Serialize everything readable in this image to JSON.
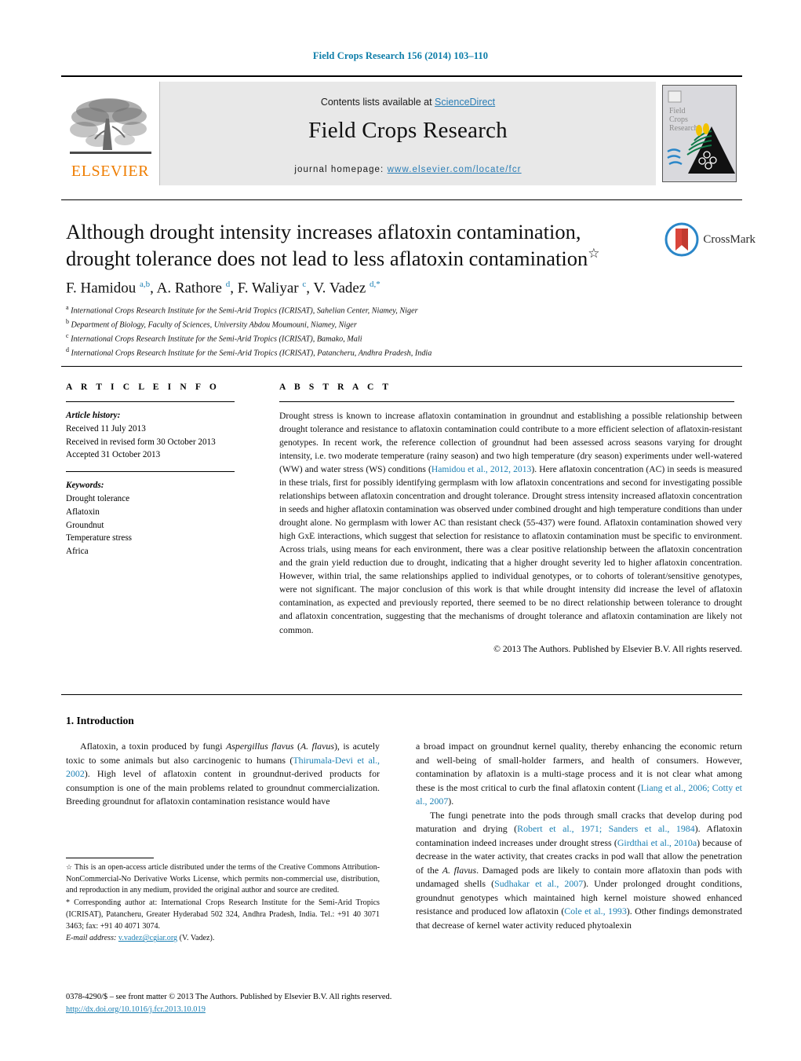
{
  "running_head": "Field Crops Research 156 (2014) 103–110",
  "masthead": {
    "publisher_logo_label": "ELSEVIER",
    "contents_prefix": "Contents lists available at ",
    "contents_link": "ScienceDirect",
    "journal_name": "Field Crops Research",
    "homepage_prefix": "journal homepage: ",
    "homepage_url": "www.elsevier.com/locate/fcr",
    "cover_title_lines": [
      "Field",
      "Crops",
      "Research"
    ]
  },
  "crossmark": {
    "label": "CrossMark"
  },
  "article": {
    "title": "Although drought intensity increases aflatoxin contamination, drought tolerance does not lead to less aflatoxin contamination",
    "title_footnote_mark": "☆",
    "authors_html": "F. Hamidou <sup>a,b</sup>, A. Rathore <sup>d</sup>, F. Waliyar <sup>c</sup>, V. Vadez <sup>d,</sup><sup>*</sup>",
    "affiliations": [
      {
        "mark": "a",
        "text": "International Crops Research Institute for the Semi-Arid Tropics (ICRISAT), Sahelian Center, Niamey, Niger"
      },
      {
        "mark": "b",
        "text": "Department of Biology, Faculty of Sciences, University Abdou Moumouni, Niamey, Niger"
      },
      {
        "mark": "c",
        "text": "International Crops Research Institute for the Semi-Arid Tropics (ICRISAT), Bamako, Mali"
      },
      {
        "mark": "d",
        "text": "International Crops Research Institute for the Semi-Arid Tropics (ICRISAT), Patancheru, Andhra Pradesh, India"
      }
    ]
  },
  "article_info": {
    "heading": "A R T I C L E    I N F O",
    "history_label": "Article history:",
    "history": [
      "Received 11 July 2013",
      "Received in revised form 30 October 2013",
      "Accepted 31 October 2013"
    ],
    "keywords_label": "Keywords:",
    "keywords": [
      "Drought tolerance",
      "Aflatoxin",
      "Groundnut",
      "Temperature stress",
      "Africa"
    ]
  },
  "abstract": {
    "heading": "A B S T R A C T",
    "body_html": "Drought stress is known to increase aflatoxin contamination in groundnut and establishing a possible relationship between drought tolerance and resistance to aflatoxin contamination could contribute to a more efficient selection of aflatoxin-resistant genotypes. In recent work, the reference collection of groundnut had been assessed across seasons varying for drought intensity, i.e. two moderate temperature (rainy season) and two high temperature (dry season) experiments under well-watered (WW) and water stress (WS) conditions (<span class=\"ref\">Hamidou et al., 2012, 2013</span>). Here aflatoxin concentration (AC) in seeds is measured in these trials, first for possibly identifying germplasm with low aflatoxin concentrations and second for investigating possible relationships between aflatoxin concentration and drought tolerance. Drought stress intensity increased aflatoxin concentration in seeds and higher aflatoxin contamination was observed under combined drought and high temperature conditions than under drought alone. No germplasm with lower AC than resistant check (55-437) were found. Aflatoxin contamination showed very high GxE interactions, which suggest that selection for resistance to aflatoxin contamination must be specific to environment. Across trials, using means for each environment, there was a clear positive relationship between the aflatoxin concentration and the grain yield reduction due to drought, indicating that a higher drought severity led to higher aflatoxin concentration. However, within trial, the same relationships applied to individual genotypes, or to cohorts of tolerant/sensitive genotypes, were not significant. The major conclusion of this work is that while drought intensity did increase the level of aflatoxin contamination, as expected and previously reported, there seemed to be no direct relationship between tolerance to drought and aflatoxin concentration, suggesting that the mechanisms of drought tolerance and aflatoxin contamination are likely not common.",
    "copyright": "© 2013 The Authors. Published by Elsevier B.V. All rights reserved."
  },
  "body": {
    "section_number_title": "1.  Introduction",
    "left_column_html": "<p>Aflatoxin, a toxin produced by fungi <em>Aspergillus flavus</em> (<em>A. flavus</em>), is acutely toxic to some animals but also carcinogenic to humans (<span class=\"ref\">Thirumala-Devi et al., 2002</span>). High level of aflatoxin content in groundnut-derived products for consumption is one of the main problems related to groundnut commercialization. Breeding groundnut for aflatoxin contamination resistance would have</p>",
    "right_column_html": "<p class=\"noindent\">a broad impact on groundnut kernel quality, thereby enhancing the economic return and well-being of small-holder farmers, and health of consumers. However, contamination by aflatoxin is a multi-stage process and it is not clear what among these is the most critical to curb the final aflatoxin content (<span class=\"ref\">Liang et al., 2006; Cotty et al., 2007</span>).</p><p>The fungi penetrate into the pods through small cracks that develop during pod maturation and drying (<span class=\"ref\">Robert et al., 1971; Sanders et al., 1984</span>). Aflatoxin contamination indeed increases under drought stress (<span class=\"ref\">Girdthai et al., 2010a</span>) because of decrease in the water activity, that creates cracks in pod wall that allow the penetration of the <em>A. flavus</em>. Damaged pods are likely to contain more aflatoxin than pods with undamaged shells (<span class=\"ref\">Sudhakar et al., 2007</span>). Under prolonged drought conditions, groundnut genotypes which maintained high kernel moisture showed enhanced resistance and produced low aflatoxin (<span class=\"ref\">Cole et al., 1993</span>). Other findings demonstrated that decrease of kernel water activity reduced phytoalexin</p>"
  },
  "footnotes": {
    "license_html": "<span class=\"fn-mark\">☆</span> This is an open-access article distributed under the terms of the Creative Commons Attribution-NonCommercial-No Derivative Works License, which permits non-commercial use, distribution, and reproduction in any medium, provided the original author and source are credited.",
    "corresponding_html": "* Corresponding author at: International Crops Research Institute for the Semi-Arid Tropics (ICRISAT), Patancheru, Greater Hyderabad 502 324, Andhra Pradesh, India. Tel.: +91 40 3071 3463; fax: +91 40 4071 3074.",
    "email_label": "E-mail address:",
    "email": "v.vadez@cgiar.org",
    "email_owner": "(V. Vadez)."
  },
  "colophon": {
    "issn_line": "0378-4290/$ – see front matter © 2013 The Authors. Published by Elsevier B.V. All rights reserved.",
    "doi": "http://dx.doi.org/10.1016/j.fcr.2013.10.019"
  },
  "colors": {
    "link_blue": "#1a7fb3",
    "sciencedirect_blue": "#2a7db5",
    "elsevier_orange": "#ef7d00",
    "masthead_grey": "#e8e8e8"
  }
}
